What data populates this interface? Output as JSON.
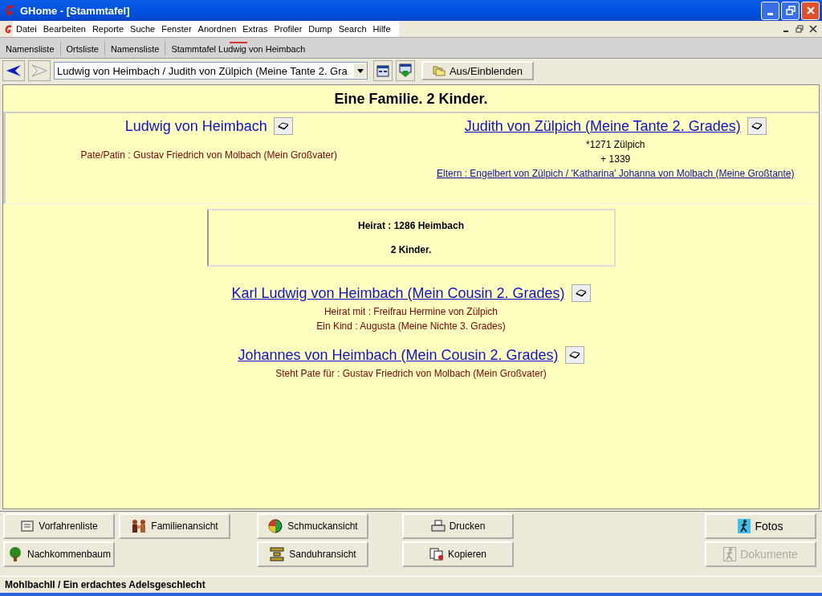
{
  "window": {
    "title": "GHome - [Stammtafel]"
  },
  "menu": [
    "Datei",
    "Bearbeiten",
    "Reporte",
    "Suche",
    "Fenster",
    "Anordnen",
    "Extras",
    "Profiler",
    "Dump",
    "Search",
    "Hilfe"
  ],
  "tabs": [
    {
      "label": "Namensliste",
      "selected": false
    },
    {
      "label": "Ortsliste",
      "selected": false
    },
    {
      "label": "Namensliste",
      "selected": false
    },
    {
      "label": "Stammtafel Ludwig von Heimbach",
      "selected": true
    }
  ],
  "toolbar": {
    "combo_value": "Ludwig von Heimbach /  Judith von Zülpich (Meine Tante 2. Gra",
    "toggle_button": "Aus/Einblenden"
  },
  "heading": "Eine Familie. 2 Kinder.",
  "partners": [
    {
      "name": "Ludwig von Heimbach",
      "linked": false,
      "lines": [
        {
          "kind": "note",
          "text": "Pate/Patin : Gustav Friedrich von Molbach (Mein Großvater)"
        }
      ]
    },
    {
      "name": "Judith von Zülpich (Meine Tante 2. Grades)",
      "linked": true,
      "lines": [
        {
          "kind": "date",
          "text": "*1271 Zülpich"
        },
        {
          "kind": "date",
          "text": "+ 1339"
        },
        {
          "kind": "link",
          "text": "Eltern : Engelbert von Zülpich / 'Katharina' Johanna von Molbach (Meine Großtante)"
        }
      ]
    }
  ],
  "marriage": [
    "Heirat : 1286 Heimbach",
    "2 Kinder."
  ],
  "children": [
    {
      "name": "Karl Ludwig von Heimbach (Mein Cousin 2. Grades)",
      "linked": true,
      "lines": [
        {
          "kind": "note",
          "text": "Heirat mit : Freifrau Hermine von Zülpich"
        },
        {
          "kind": "note",
          "text": "Ein Kind : Augusta (Meine Nichte 3. Grades)"
        }
      ]
    },
    {
      "name": "Johannes von Heimbach (Mein Cousin 2. Grades)",
      "linked": true,
      "lines": [
        {
          "kind": "note",
          "text": "Steht Pate für : Gustav Friedrich von Molbach (Mein Großvater)"
        }
      ]
    }
  ],
  "button_columns": [
    [
      {
        "label": "Vorfahrenliste",
        "disabled": false
      },
      {
        "label": "Nachkommenbaum",
        "disabled": false
      }
    ],
    [
      {
        "label": "Familienansicht",
        "disabled": false
      }
    ],
    [
      {
        "label": "Schmuckansicht",
        "disabled": false
      },
      {
        "label": "Sanduhransicht",
        "disabled": false
      }
    ],
    [
      {
        "label": "Drucken",
        "disabled": false
      },
      {
        "label": "Kopieren",
        "disabled": false
      }
    ],
    [
      {
        "label": "Fotos",
        "disabled": false
      },
      {
        "label": "Dokumente",
        "disabled": true
      }
    ]
  ],
  "status_bar": "MohlbachII / Ein erdachtes Adelsgeschlecht"
}
